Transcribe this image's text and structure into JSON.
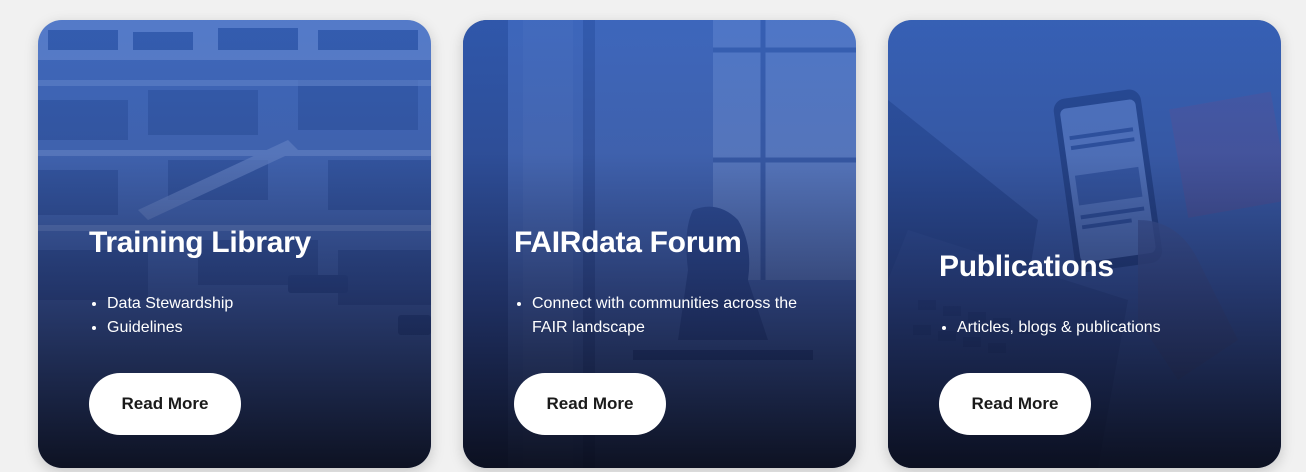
{
  "cards": [
    {
      "title": "Training Library",
      "bullets": [
        "Data Stewardship",
        "Guidelines"
      ],
      "button_label": "Read More",
      "image": "library-photo"
    },
    {
      "title": "FAIRdata Forum",
      "bullets": [
        "Connect with communities across the FAIR landscape"
      ],
      "button_label": "Read More",
      "image": "office-window-photo"
    },
    {
      "title": "Publications",
      "bullets": [
        "Articles, blogs & publications"
      ],
      "button_label": "Read More",
      "image": "phone-laptop-photo"
    }
  ],
  "colors": {
    "page_background": "#f1f1f1",
    "overlay_blue": "#2c5cbe",
    "overlay_dark": "#0a0e1e",
    "button_background": "#ffffff",
    "button_text": "#1a1a1a",
    "title_text": "#ffffff"
  }
}
